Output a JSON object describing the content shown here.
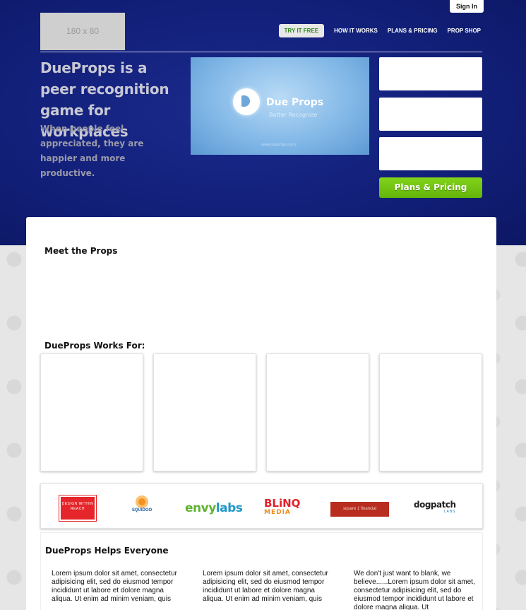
{
  "header": {
    "signin_label": "Sign In",
    "logo_placeholder": "180 x 80",
    "nav": {
      "try_free": "TRY IT FREE",
      "how_it_works": "HOW IT WORKS",
      "plans_pricing": "PLANS & PRICING",
      "prop_shop": "PROP SHOP"
    }
  },
  "hero": {
    "headline": "DueProps is a peer recognition game for workplaces",
    "subline": "When people feel appreciated, they are happier and more productive.",
    "video": {
      "title": "Due Props",
      "subtitle": "Better Recognize",
      "url": "www.dueprops.com"
    },
    "plans_button": "Plans & Pricing"
  },
  "main": {
    "meet_title": "Meet the Props",
    "works_for_title": "DueProps Works For:",
    "client_logos": [
      {
        "name": "Design Within Reach",
        "text": "DESIGN WITHIN REACH",
        "color": "#e5252a"
      },
      {
        "name": "Squidoo",
        "text": "SQUIDOO",
        "color": "#f39121"
      },
      {
        "name": "envylabs",
        "text_a": "envy",
        "text_b": "labs",
        "color": "#5fb431"
      },
      {
        "name": "BLiNQ Media",
        "text_a": "BLiNQ",
        "text_b": "MEDIA",
        "color": "#e3202b"
      },
      {
        "name": "square 1 financial",
        "text": "square 1 financial",
        "color": "#b92d1f"
      },
      {
        "name": "dogpatch labs",
        "text_a": "dogpatch",
        "text_b": "LABS",
        "color": "#222222"
      }
    ],
    "helps_title": "DueProps Helps Everyone",
    "columns": [
      "Lorem ipsum dolor sit amet, consectetur adipisicing elit, sed do eiusmod tempor incididunt ut labore et dolore magna aliqua. Ut enim ad minim veniam, quis",
      "Lorem ipsum dolor sit amet, consectetur adipisicing elit, sed do eiusmod tempor incididunt ut labore et dolore magna aliqua. Ut enim ad minim veniam, quis",
      "We don't just want to blank, we believe......Lorem ipsum dolor sit amet, consectetur adipisicing elit, sed do eiusmod tempor incididunt ut labore et dolore magna aliqua. Ut"
    ]
  },
  "colors": {
    "hero_bg": "#12207a",
    "accent_green": "#6cc010",
    "try_free_text": "#2d8a1a"
  }
}
